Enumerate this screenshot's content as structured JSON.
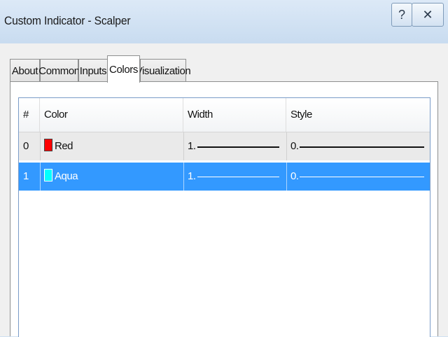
{
  "window": {
    "title": "Custom Indicator - Scalper",
    "help_glyph": "?",
    "close_glyph": "✕"
  },
  "tabs": [
    {
      "label": "About"
    },
    {
      "label": "Common"
    },
    {
      "label": "Inputs"
    },
    {
      "label": "Colors",
      "active": true
    },
    {
      "label": "Visualization"
    }
  ],
  "table": {
    "columns": [
      "#",
      "Color",
      "Width",
      "Style"
    ],
    "rows": [
      {
        "index": "0",
        "color_name": "Red",
        "color_hex": "#ff0000",
        "width": "1.",
        "style": "0.",
        "selected": false
      },
      {
        "index": "1",
        "color_name": "Aqua",
        "color_hex": "#00ffff",
        "width": "1.",
        "style": "0.",
        "selected": true
      }
    ]
  },
  "colors": {
    "selection": "#3399ff",
    "title_bg": "#c9dcf0"
  }
}
